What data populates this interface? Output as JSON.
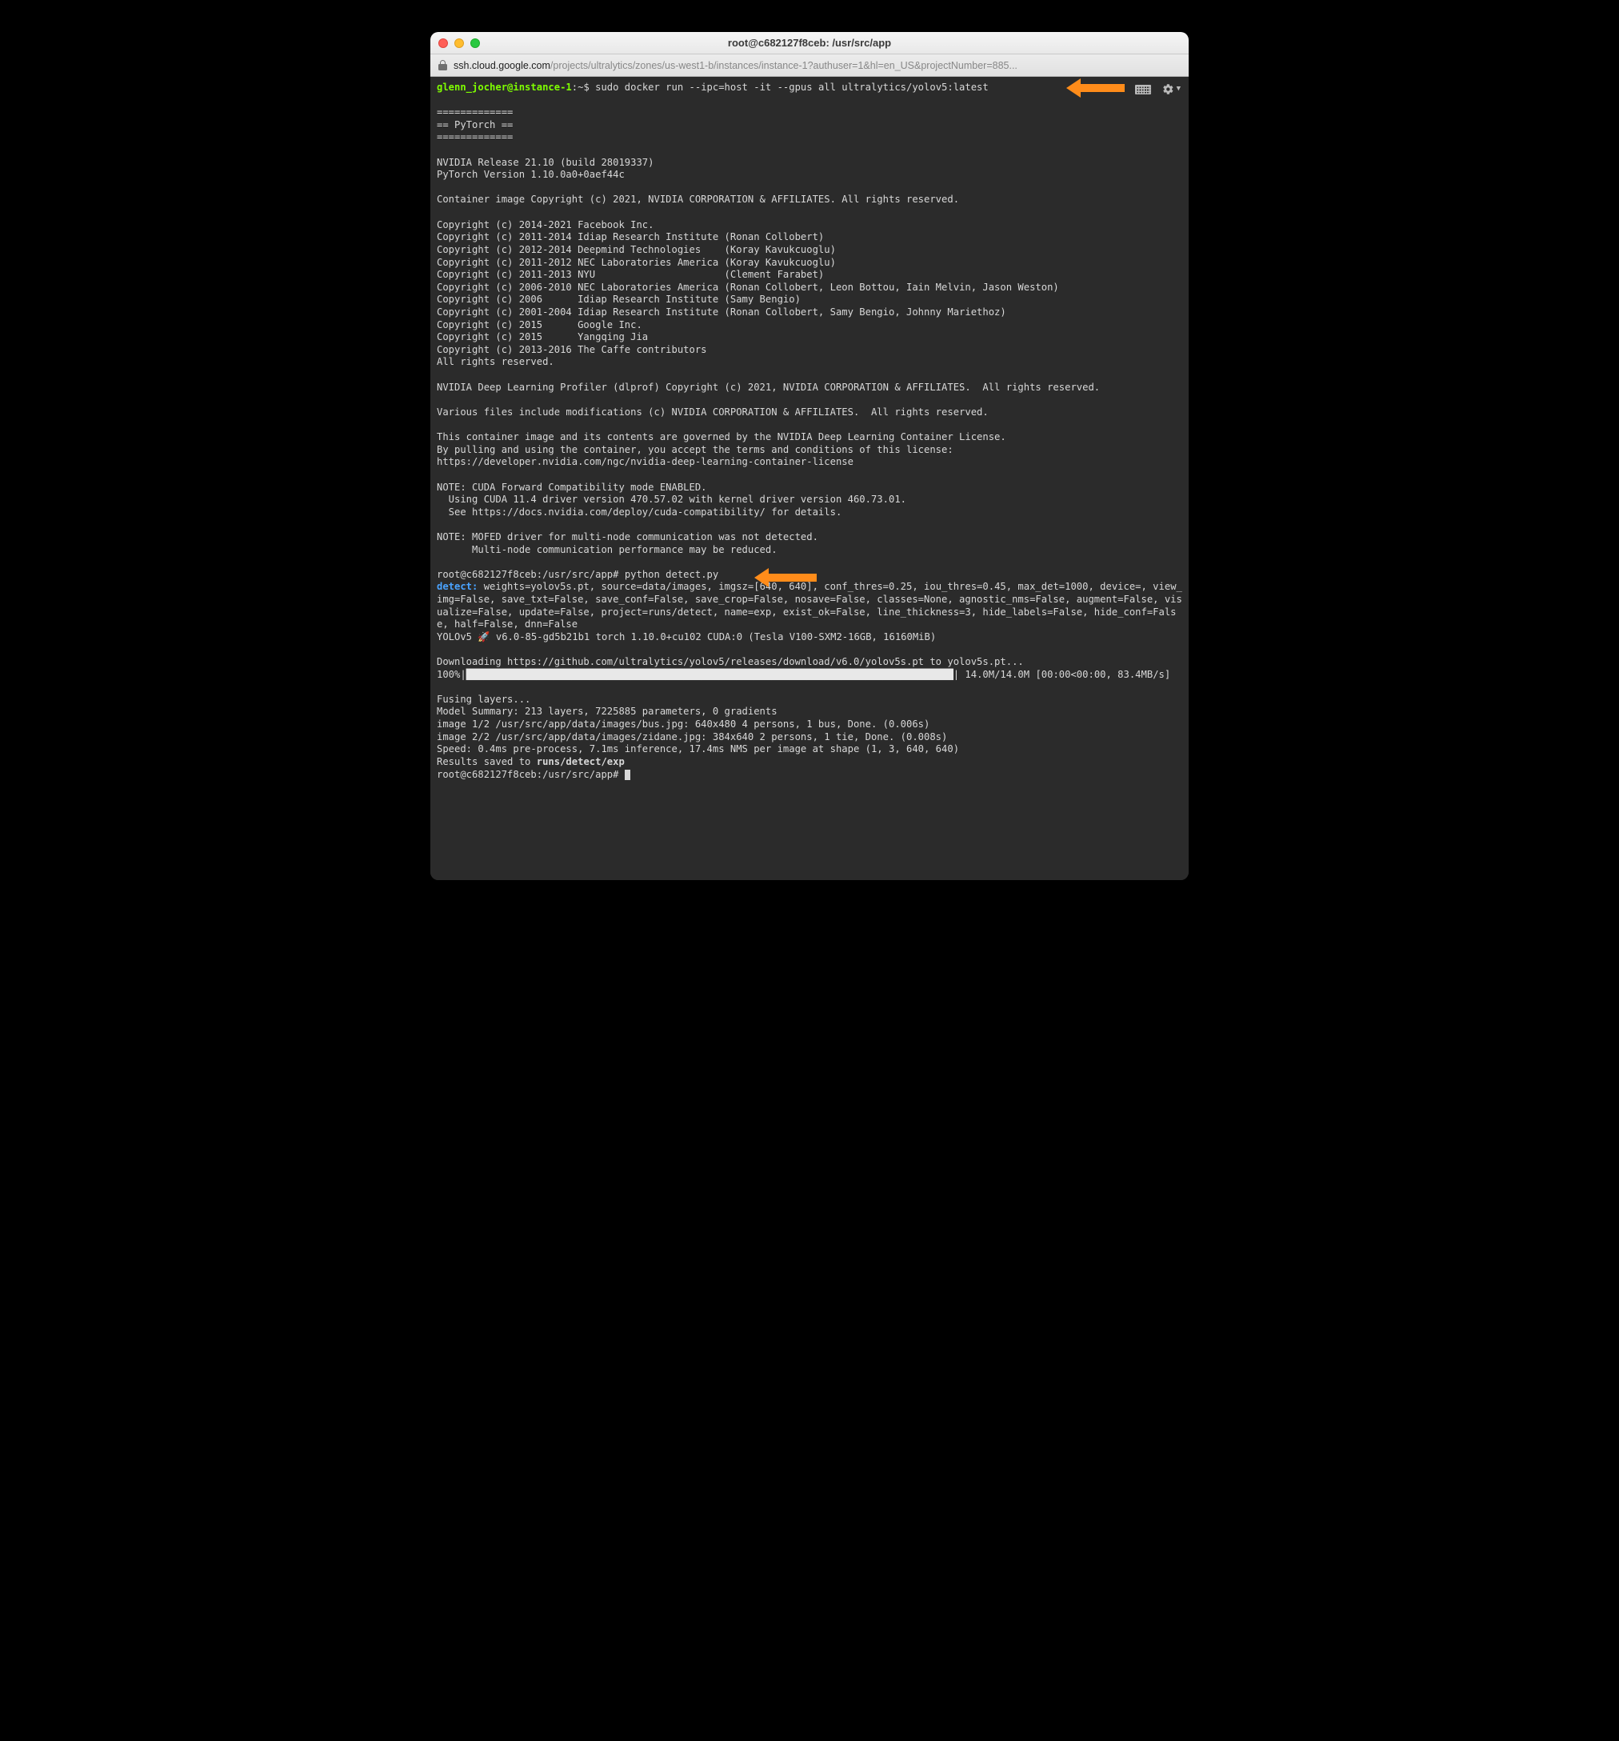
{
  "window": {
    "title": "root@c682127f8ceb: /usr/src/app",
    "url_host": "ssh.cloud.google.com",
    "url_path": "/projects/ultralytics/zones/us-west1-b/instances/instance-1?authuser=1&hl=en_US&projectNumber=885..."
  },
  "prompt1": {
    "user": "glenn_jocher@instance-1",
    "sep": ":~$ ",
    "cmd": "sudo docker run --ipc=host -it --gpus all ultralytics/yolov5:latest"
  },
  "banner": {
    "rule": "=============",
    "title": "== PyTorch =="
  },
  "body1": "NVIDIA Release 21.10 (build 28019337)\nPyTorch Version 1.10.0a0+0aef44c\n\nContainer image Copyright (c) 2021, NVIDIA CORPORATION & AFFILIATES. All rights reserved.\n\nCopyright (c) 2014-2021 Facebook Inc.\nCopyright (c) 2011-2014 Idiap Research Institute (Ronan Collobert)\nCopyright (c) 2012-2014 Deepmind Technologies    (Koray Kavukcuoglu)\nCopyright (c) 2011-2012 NEC Laboratories America (Koray Kavukcuoglu)\nCopyright (c) 2011-2013 NYU                      (Clement Farabet)\nCopyright (c) 2006-2010 NEC Laboratories America (Ronan Collobert, Leon Bottou, Iain Melvin, Jason Weston)\nCopyright (c) 2006      Idiap Research Institute (Samy Bengio)\nCopyright (c) 2001-2004 Idiap Research Institute (Ronan Collobert, Samy Bengio, Johnny Mariethoz)\nCopyright (c) 2015      Google Inc.\nCopyright (c) 2015      Yangqing Jia\nCopyright (c) 2013-2016 The Caffe contributors\nAll rights reserved.\n\nNVIDIA Deep Learning Profiler (dlprof) Copyright (c) 2021, NVIDIA CORPORATION & AFFILIATES.  All rights reserved.\n\nVarious files include modifications (c) NVIDIA CORPORATION & AFFILIATES.  All rights reserved.\n\nThis container image and its contents are governed by the NVIDIA Deep Learning Container License.\nBy pulling and using the container, you accept the terms and conditions of this license:\nhttps://developer.nvidia.com/ngc/nvidia-deep-learning-container-license\n\nNOTE: CUDA Forward Compatibility mode ENABLED.\n  Using CUDA 11.4 driver version 470.57.02 with kernel driver version 460.73.01.\n  See https://docs.nvidia.com/deploy/cuda-compatibility/ for details.\n\nNOTE: MOFED driver for multi-node communication was not detected.\n      Multi-node communication performance may be reduced.\n",
  "prompt2": {
    "prefix": "root@c682127f8ceb:/usr/src/app# ",
    "cmd": "python detect.py"
  },
  "detect": {
    "label": "detect: ",
    "args": "weights=yolov5s.pt, source=data/images, imgsz=[640, 640], conf_thres=0.25, iou_thres=0.45, max_det=1000, device=, view_img=False, save_txt=False, save_conf=False, save_crop=False, nosave=False, classes=None, agnostic_nms=False, augment=False, visualize=False, update=False, project=runs/detect, name=exp, exist_ok=False, line_thickness=3, hide_labels=False, hide_conf=False, half=False, dnn=False"
  },
  "yolo_line": "YOLOv5 🚀 v6.0-85-gd5b21b1 torch 1.10.0+cu102 CUDA:0 (Tesla V100-SXM2-16GB, 16160MiB)",
  "download": "Downloading https://github.com/ultralytics/yolov5/releases/download/v6.0/yolov5s.pt to yolov5s.pt...",
  "progress": {
    "pct": "100%",
    "bar": "███████████████████████████████████████████████████████████████████████████████████",
    "stats": " 14.0M/14.0M [00:00<00:00, 83.4MB/s]"
  },
  "body2_pre": "Fusing layers...\nModel Summary: 213 layers, 7225885 parameters, 0 gradients\nimage 1/2 /usr/src/app/data/images/bus.jpg: 640x480 4 persons, 1 bus, Done. (0.006s)\nimage 2/2 /usr/src/app/data/images/zidane.jpg: 384x640 2 persons, 1 tie, Done. (0.008s)\nSpeed: 0.4ms pre-process, 7.1ms inference, 17.4ms NMS per image at shape (1, 3, 640, 640)",
  "results_prefix": "Results saved to ",
  "results_path": "runs/detect/exp",
  "prompt3": "root@c682127f8ceb:/usr/src/app# "
}
